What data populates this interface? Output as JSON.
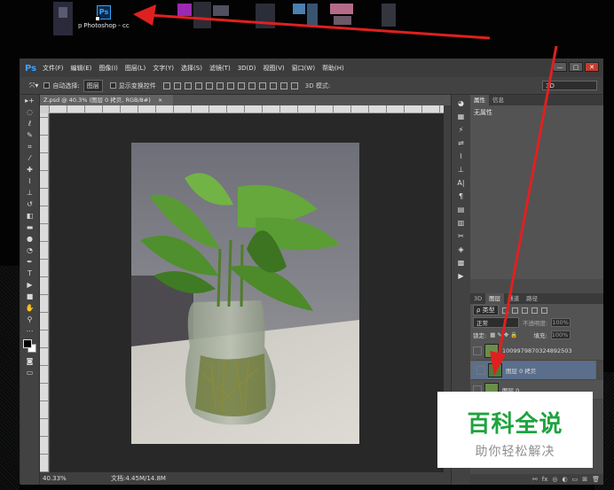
{
  "desktop": {
    "icon_label": "Photoshop - cc",
    "icon_letters": "Ps",
    "left_fragment": "p"
  },
  "app": {
    "logo": "Ps",
    "menu": [
      "文件(F)",
      "编辑(E)",
      "图像(I)",
      "图层(L)",
      "文字(Y)",
      "选择(S)",
      "滤镜(T)",
      "3D(D)",
      "视图(V)",
      "窗口(W)",
      "帮助(H)"
    ],
    "window_controls": [
      "—",
      "□",
      "✕"
    ]
  },
  "options_bar": {
    "auto_select_label": "自动选择:",
    "auto_select_value": "图层",
    "show_transform_label": "显示变换控件",
    "mode_3d_label": "3D 模式:",
    "workspace_value": "3D"
  },
  "document": {
    "tab_title": "Z.psd @ 40.3% (图层 0 拷贝, RGB/8#)",
    "tab_close": "×",
    "zoom": "40.33%",
    "doc_size": "文档:4.45M/14.8M"
  },
  "properties_panel": {
    "tabs": [
      "属性",
      "信息"
    ],
    "body": "无属性"
  },
  "layers_panel": {
    "tabs": [
      "3D",
      "图层",
      "通道",
      "路径"
    ],
    "filter_type": "ρ 类型",
    "blend_mode": "正常",
    "opacity_label": "不透明度:",
    "opacity_value": "100%",
    "lock_label": "锁定:",
    "fill_label": "填充:",
    "fill_value": "100%",
    "layers": [
      {
        "name": "1009979870324892503",
        "selected": false
      },
      {
        "name": "图层 0 拷贝",
        "selected": true
      },
      {
        "name": "图层 0",
        "selected": false
      }
    ],
    "bottom_icons": [
      "fx",
      "◎",
      "◐",
      "▭",
      "⊞",
      "🗑"
    ]
  },
  "watermark": {
    "title": "百科全说",
    "subtitle": "助你轻松解决"
  },
  "colors": {
    "annotation_arrow": "#e02020",
    "watermark_green": "#1fa33f",
    "selected_layer": "#5b6f8c"
  }
}
